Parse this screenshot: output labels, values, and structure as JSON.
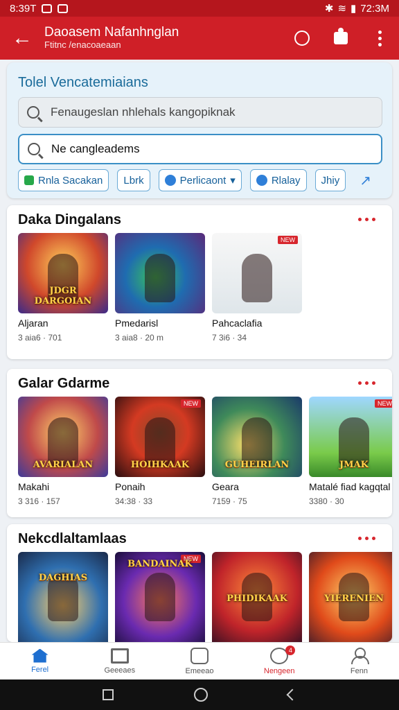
{
  "status": {
    "left_time": "8:39T",
    "right_time": "72:3M"
  },
  "appbar": {
    "title": "Daoasem Nafanhnglan",
    "subtitle": "Ftitnc /enacoaeaan"
  },
  "search_card": {
    "heading": "Tolel Vencatemiaians",
    "field1_text": "Fenaugeslan nhlehals kangopiknak",
    "field2_text": "Ne cangleadems",
    "chips": [
      "Rnla Sacakan",
      "Lbrk",
      "Perlicaont",
      "Rlalay",
      "Jhiy"
    ]
  },
  "sections": [
    {
      "title": "Daka Dingalans",
      "tiles": [
        {
          "name": "Aljaran",
          "meta": "3 aia6 · 701",
          "art": "JDGR DARGOIAN",
          "badge": ""
        },
        {
          "name": "Pmedarisl",
          "meta": "3 aia8 · 20 m",
          "art": "",
          "badge": ""
        },
        {
          "name": "Pahcaclafia",
          "meta": "7 3i6 · 34",
          "art": "",
          "badge": "NEW"
        }
      ]
    },
    {
      "title": "Galar Gdarme",
      "tiles": [
        {
          "name": "Makahi",
          "meta": "3 316 · 157",
          "art": "AVARIALAN",
          "badge": ""
        },
        {
          "name": "Ponaih",
          "meta": "34:38 · 33",
          "art": "HOIHKAAK",
          "badge": "NEW"
        },
        {
          "name": "Geara",
          "meta": "7159 · 75",
          "art": "GUHEIRLAN",
          "badge": ""
        },
        {
          "name": "Matalé fiad kagqtal",
          "meta": "3380 · 30",
          "art": "JMAK",
          "badge": "NEW"
        }
      ]
    },
    {
      "title": "Nekcdlaltamlaas",
      "tiles": [
        {
          "name": "",
          "meta": "",
          "art": "DAGHIAS",
          "badge": ""
        },
        {
          "name": "",
          "meta": "",
          "art": "BANDAINAK",
          "badge": "NEW"
        },
        {
          "name": "",
          "meta": "",
          "art": "PHIDIKAAK",
          "badge": ""
        },
        {
          "name": "",
          "meta": "",
          "art": "YIERENIEN",
          "badge": ""
        }
      ]
    }
  ],
  "bottom_nav": {
    "items": [
      "Ferel",
      "Geeeaes",
      "Emeeao",
      "Nengeen",
      "Fenn"
    ],
    "badge": "4"
  },
  "colors": {
    "brand_red": "#cf1f27",
    "accent_blue": "#1e6fd0"
  }
}
